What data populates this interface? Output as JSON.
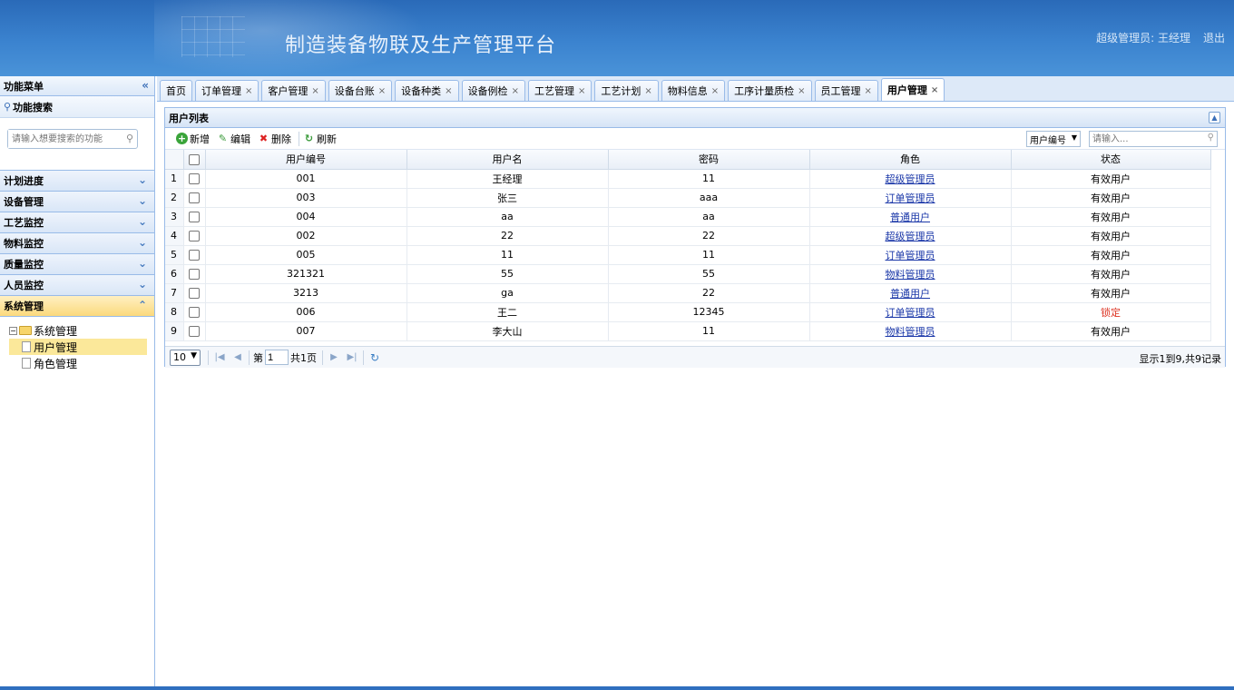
{
  "header": {
    "title": "制造装备物联及生产管理平台",
    "user_label": "超级管理员: 王经理",
    "logout": "退出"
  },
  "sidebar": {
    "title": "功能菜单",
    "search_title": "功能搜索",
    "search_placeholder": "请输入想要搜索的功能",
    "menu": [
      "计划进度",
      "设备管理",
      "工艺监控",
      "物料监控",
      "质量监控",
      "人员监控",
      "系统管理"
    ],
    "tree": {
      "root": "系统管理",
      "children": [
        "用户管理",
        "角色管理"
      ]
    }
  },
  "tabs": [
    "首页",
    "订单管理",
    "客户管理",
    "设备台账",
    "设备种类",
    "设备例检",
    "工艺管理",
    "工艺计划",
    "物料信息",
    "工序计量质检",
    "员工管理",
    "用户管理"
  ],
  "active_tab": "用户管理",
  "panel": {
    "title": "用户列表",
    "toolbar": {
      "add": "新增",
      "edit": "编辑",
      "delete": "删除",
      "refresh": "刷新"
    },
    "search_field": "用户编号",
    "search_placeholder": "请输入..."
  },
  "table": {
    "columns": [
      "用户编号",
      "用户名",
      "密码",
      "角色",
      "状态"
    ],
    "rows": [
      {
        "n": "1",
        "id": "001",
        "name": "王经理",
        "pwd": "11",
        "role": "超级管理员",
        "status": "有效用户"
      },
      {
        "n": "2",
        "id": "003",
        "name": "张三",
        "pwd": "aaa",
        "role": "订单管理员",
        "status": "有效用户"
      },
      {
        "n": "3",
        "id": "004",
        "name": "aa",
        "pwd": "aa",
        "role": "普通用户",
        "status": "有效用户"
      },
      {
        "n": "4",
        "id": "002",
        "name": "22",
        "pwd": "22",
        "role": "超级管理员",
        "status": "有效用户"
      },
      {
        "n": "5",
        "id": "005",
        "name": "11",
        "pwd": "11",
        "role": "订单管理员",
        "status": "有效用户"
      },
      {
        "n": "6",
        "id": "321321",
        "name": "55",
        "pwd": "55",
        "role": "物料管理员",
        "status": "有效用户"
      },
      {
        "n": "7",
        "id": "3213",
        "name": "ga",
        "pwd": "22",
        "role": "普通用户",
        "status": "有效用户"
      },
      {
        "n": "8",
        "id": "006",
        "name": "王二",
        "pwd": "12345",
        "role": "订单管理员",
        "status": "锁定"
      },
      {
        "n": "9",
        "id": "007",
        "name": "李大山",
        "pwd": "11",
        "role": "物料管理员",
        "status": "有效用户"
      }
    ]
  },
  "pager": {
    "page_size": "10",
    "page_prefix": "第",
    "page_value": "1",
    "page_suffix": "共1页",
    "info": "显示1到9,共9记录"
  },
  "colors": {
    "header_blue": "#3b83cf",
    "locked_red": "#dd3322",
    "link_blue": "#1a37a8",
    "selected_yellow": "#fbe89a"
  }
}
